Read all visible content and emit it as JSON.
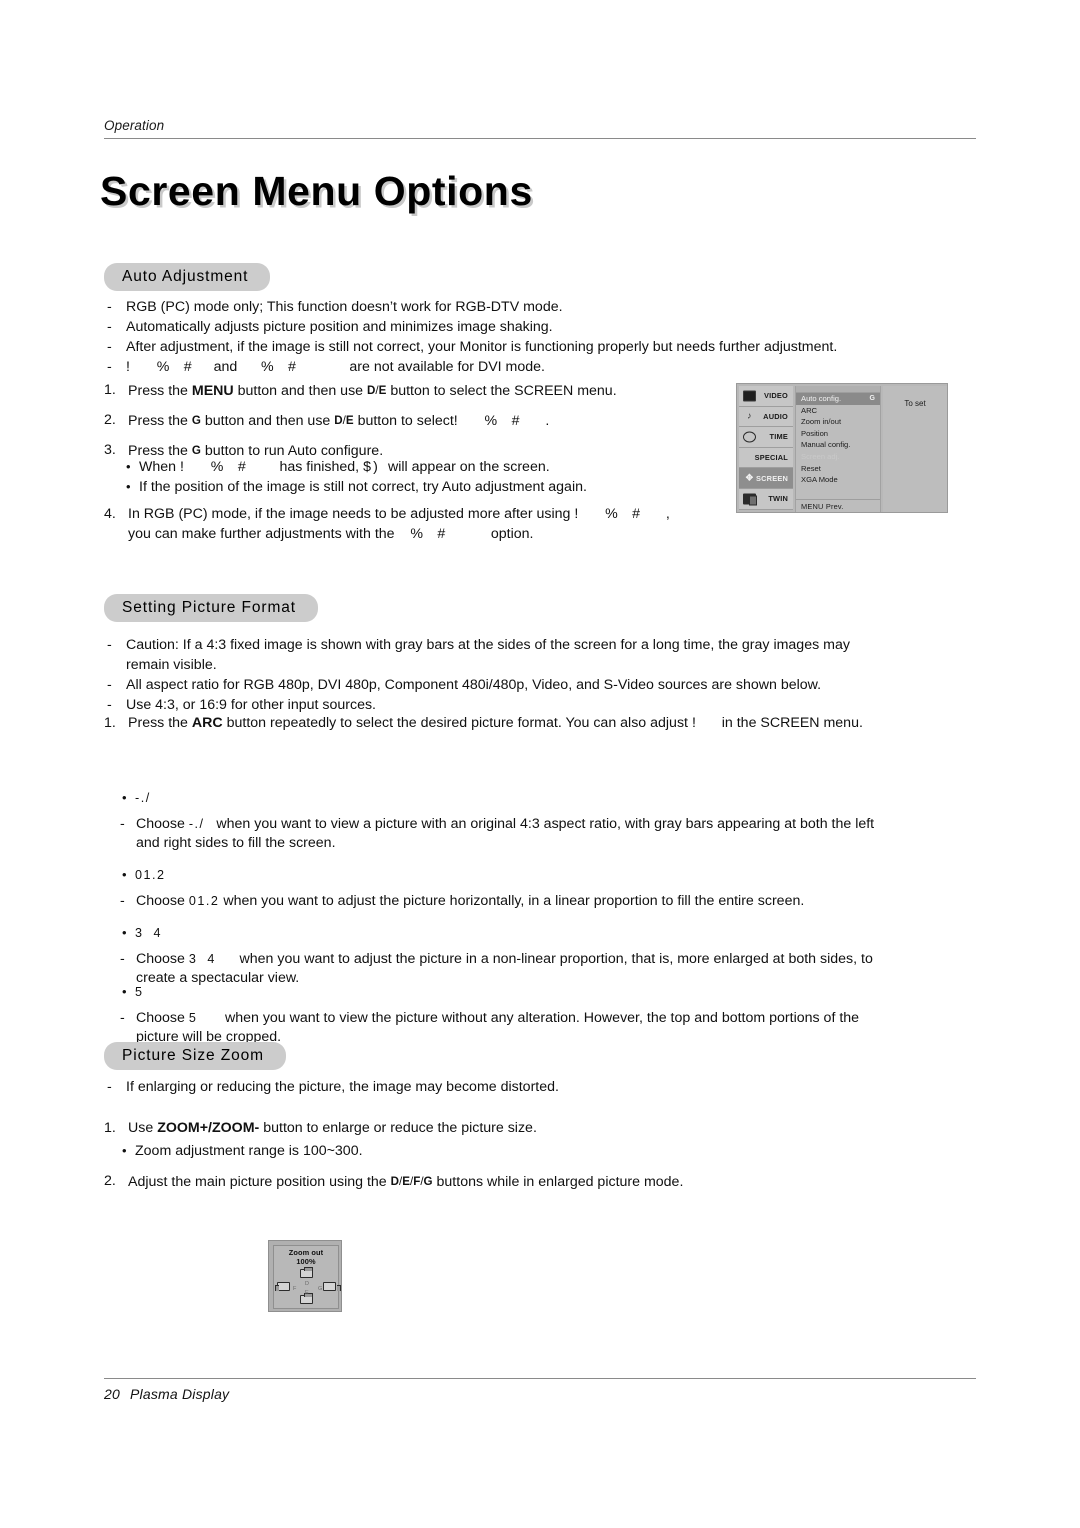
{
  "running_head": "Operation",
  "title": "Screen Menu Options",
  "footer": {
    "page_number": "20",
    "label": "Plasma Display"
  },
  "sections": {
    "auto_adjustment": {
      "heading": "Auto Adjustment",
      "notes": [
        "RGB (PC) mode only; This function doesn’t work for RGB-DTV mode.",
        "Automatically adjusts picture position and minimizes image shaking.",
        "After adjustment, if the image is still not correct, your Monitor is functioning properly but needs further adjustment."
      ],
      "note4_pre": "",
      "note4_glyph_a": "!    %  #",
      "note4_mid": "and",
      "note4_glyph_b": "%  #",
      "note4_post": "are not available for DVI mode.",
      "steps": {
        "s1_num": "1.",
        "s1_a": "Press the",
        "s1_bold": "MENU",
        "s1_b": "button and then use",
        "s1_key1": "D",
        "s1_sep": "/",
        "s1_key2": "E",
        "s1_c": "button to select the SCREEN menu.",
        "s2_num": "2.",
        "s2_a": "Press the",
        "s2_key0": "G",
        "s2_b": "button and then use",
        "s2_key1": "D",
        "s2_sep": "/",
        "s2_key2": "E",
        "s2_c": "button to select",
        "s2_glyph": "!    %  #",
        "s2_d": ".",
        "s3_num": "3.",
        "s3_a": "Press the",
        "s3_key0": "G",
        "s3_b": "button to run Auto configure.",
        "b1_pre": "When",
        "b1_glyph": "!    %  #",
        "b1_mid": "has finished,",
        "b1_glyph2": "$)",
        "b1_post": "will appear on the screen.",
        "b2": "If the position of the image is still not correct, try Auto adjustment again.",
        "s4_num": "4.",
        "s4_a": "In RGB (PC) mode, if the image needs to be adjusted more after using",
        "s4_glyph": "!    %  #",
        "s4_comma": ",",
        "s4_b": "you can make further adjustments with the",
        "s4_glyph2": "%  #",
        "s4_c": "option."
      },
      "osd": {
        "tabs": [
          {
            "label": "VIDEO",
            "icon": "video-icon",
            "selected": false
          },
          {
            "label": "AUDIO",
            "icon": "audio-icon",
            "selected": false
          },
          {
            "label": "TIME",
            "icon": "time-icon",
            "selected": false
          },
          {
            "label": "SPECIAL",
            "icon": "",
            "selected": false
          },
          {
            "label": "SCREEN",
            "icon": "screen-icon",
            "selected": true
          },
          {
            "label": "TWIN",
            "icon": "twin-icon",
            "selected": false
          }
        ],
        "items": [
          {
            "label": "Auto config.",
            "state": "selected",
            "mark": "G"
          },
          {
            "label": "ARC",
            "state": "normal",
            "mark": ""
          },
          {
            "label": "Zoom in/out",
            "state": "normal",
            "mark": ""
          },
          {
            "label": "Position",
            "state": "normal",
            "mark": ""
          },
          {
            "label": "Manual config.",
            "state": "normal",
            "mark": ""
          },
          {
            "label": "Screen adj.",
            "state": "dim",
            "mark": ""
          },
          {
            "label": "Reset",
            "state": "normal",
            "mark": ""
          },
          {
            "label": "XGA Mode",
            "state": "normal",
            "mark": ""
          }
        ],
        "footer": "MENU  Prev.",
        "right_panel": "To set"
      }
    },
    "setting_picture_format": {
      "heading": "Setting Picture Format",
      "notes": [
        "Caution: If a 4:3 fixed image is shown with gray bars at the sides of the screen for a long time, the gray images may remain visible.",
        "All aspect ratio for RGB 480p, DVI 480p, Component 480i/480p, Video, and S-Video sources are shown below.",
        "Use 4:3, or 16:9 for other input sources."
      ],
      "step1_num": "1.",
      "step1_a": "Press the",
      "step1_bold": "ARC",
      "step1_b": "button repeatedly to select the desired picture format. You can also adjust",
      "step1_glyph": "!",
      "step1_c": "in the SCREEN menu.",
      "formats": [
        {
          "name": "-./",
          "choose_pre": "Choose",
          "choose_glyph": "-./",
          "desc": "when you want to view a picture with an original 4:3 aspect ratio, with gray bars appearing at both the left and right sides to fill the screen."
        },
        {
          "name": "01.2",
          "choose_pre": "Choose",
          "choose_glyph": "01.2",
          "desc": "when you want to adjust the picture horizontally, in a linear proportion to fill the entire screen."
        },
        {
          "name": "3  4",
          "choose_pre": "Choose",
          "choose_glyph": "3  4",
          "desc": "when you want to adjust the picture in a non-linear proportion, that is, more enlarged at both sides, to create a spectacular view."
        },
        {
          "name": "5",
          "choose_pre": "Choose",
          "choose_glyph": "5",
          "desc": "when you want to view the picture without any alteration. However, the top and bottom portions of the picture will be cropped."
        }
      ]
    },
    "picture_size_zoom": {
      "heading": "Picture Size Zoom",
      "notes": [
        "If enlarging or reducing the picture, the image may become distorted."
      ],
      "step1_num": "1.",
      "step1_a": "Use",
      "step1_bold": "ZOOM+/ZOOM-",
      "step1_b": "button to enlarge or reduce the picture size.",
      "bullet1": "Zoom adjustment range is 100~300.",
      "step2_num": "2.",
      "step2_a": "Adjust the main picture position using the",
      "step2_key1": "D",
      "step2_sep1": "/",
      "step2_key2": "E",
      "step2_sep2": "/",
      "step2_key3": "F",
      "step2_sep3": "/",
      "step2_key4": "G",
      "step2_b": "buttons while in enlarged picture mode.",
      "zoom_osd": {
        "title": "Zoom out",
        "percent": "100%",
        "pad_d": "D",
        "pad_e": "E",
        "pad_f": "F",
        "pad_g": "G"
      }
    }
  }
}
